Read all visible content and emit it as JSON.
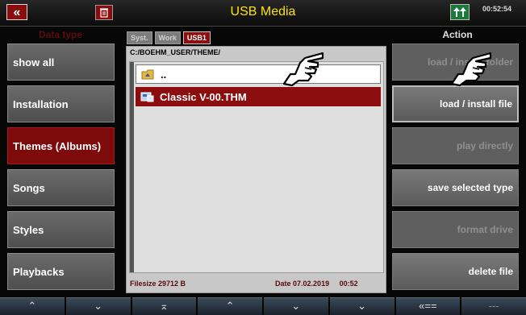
{
  "window": {
    "title": "USB Media",
    "time": "00:52:54"
  },
  "top_icons": {
    "back": "close-icon",
    "trash": "trash-icon",
    "registration": "registration-icon"
  },
  "left_header": "Data type",
  "right_header": "Action",
  "left_menu": [
    {
      "label": "show all",
      "active": false
    },
    {
      "label": "Installation",
      "active": false
    },
    {
      "label": "Themes (Albums)",
      "active": true
    },
    {
      "label": "Songs",
      "active": false
    },
    {
      "label": "Styles",
      "active": false
    },
    {
      "label": "Playbacks",
      "active": false
    }
  ],
  "tabs": [
    {
      "label": "Syst.",
      "active": false
    },
    {
      "label": "Work",
      "active": false
    },
    {
      "label": "USB1",
      "active": true
    }
  ],
  "path": "C:/BOEHM_USER/THEME/",
  "files": [
    {
      "label": "..",
      "icon": "folder-up-icon",
      "selected": false
    },
    {
      "label": "Classic V-00.THM",
      "icon": "theme-file-icon",
      "selected": true
    }
  ],
  "status": {
    "filesize_label": "Filesize",
    "filesize": "29712 B",
    "date_label": "Date",
    "date": "07.02.2019",
    "time": "00:52"
  },
  "actions": [
    {
      "label": "load / install folder",
      "enabled": false,
      "highlighted": false
    },
    {
      "label": "load / install file",
      "enabled": true,
      "highlighted": true
    },
    {
      "label": "play directly",
      "enabled": false,
      "highlighted": false
    },
    {
      "label": "save selected type",
      "enabled": true,
      "highlighted": false
    },
    {
      "label": "format drive",
      "enabled": false,
      "highlighted": false
    },
    {
      "label": "delete file",
      "enabled": true,
      "highlighted": false
    }
  ],
  "bottom_nav": [
    {
      "glyph": "⌃",
      "icon": "double-up-icon"
    },
    {
      "glyph": "⌄",
      "icon": "double-down-icon"
    },
    {
      "glyph": "⌅",
      "icon": "top-icon"
    },
    {
      "glyph": "⌃",
      "icon": "double-up-icon"
    },
    {
      "glyph": "⌄",
      "icon": "double-down-icon"
    },
    {
      "glyph": "⌄",
      "icon": "bottom-icon"
    },
    {
      "glyph": "«==",
      "icon": "back-icon"
    },
    {
      "glyph": "---",
      "icon": "none"
    }
  ]
}
